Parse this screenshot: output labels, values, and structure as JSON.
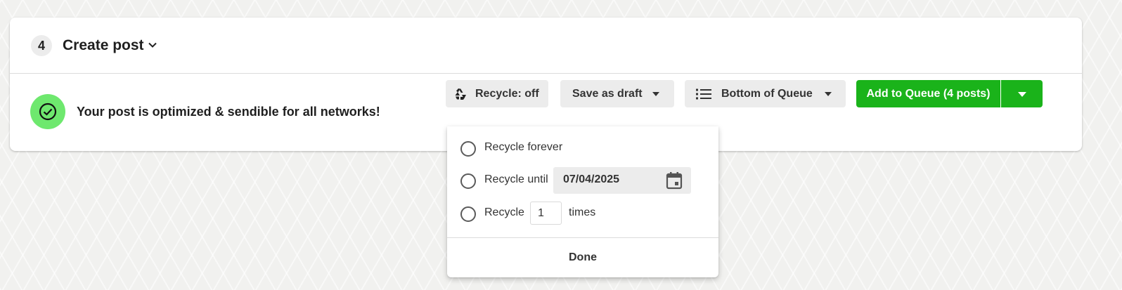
{
  "step": {
    "number": "4",
    "title": "Create post"
  },
  "status": {
    "message": "Your post is optimized & sendible for all networks!"
  },
  "toolbar": {
    "recycle_label": "Recycle: off",
    "draft_label": "Save as draft",
    "queue_label": "Bottom of Queue",
    "add_label": "Add to Queue (4 posts)"
  },
  "recycle_menu": {
    "option_forever": "Recycle forever",
    "option_until": "Recycle until",
    "until_date": "07/04/2025",
    "option_times_prefix": "Recycle",
    "times_value": "1",
    "option_times_suffix": "times",
    "done_label": "Done"
  },
  "colors": {
    "accent_green": "#1ab31a",
    "status_green": "#6ee86e"
  }
}
